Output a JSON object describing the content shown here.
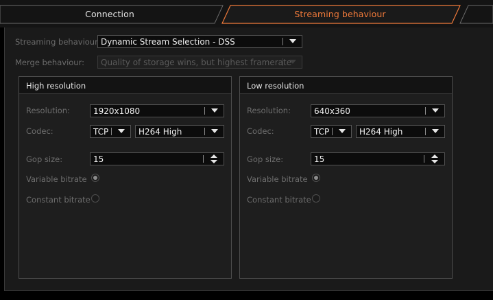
{
  "tabs": {
    "connection": "Connection",
    "streaming": "Streaming behaviour"
  },
  "colors": {
    "accent": "#f07a3a",
    "background": "#1a1a1a",
    "field": "#0c0c0c"
  },
  "form": {
    "streaming_label": "Streaming behaviour:",
    "streaming_value": "Dynamic Stream Selection - DSS",
    "merge_label": "Merge behaviour:",
    "merge_value": "Quality of storage wins, but highest framerate"
  },
  "high": {
    "title": "High resolution",
    "resolution_label": "Resolution:",
    "resolution_value": "1920x1080",
    "codec_label": "Codec:",
    "protocol_value": "TCP",
    "codec_value": "H264 High",
    "gop_label": "Gop size:",
    "gop_value": "15",
    "variable_label": "Variable bitrate",
    "constant_label": "Constant bitrate",
    "variable_selected": true
  },
  "low": {
    "title": "Low resolution",
    "resolution_label": "Resolution:",
    "resolution_value": "640x360",
    "codec_label": "Codec:",
    "protocol_value": "TCP",
    "codec_value": "H264 High",
    "gop_label": "Gop size:",
    "gop_value": "15",
    "variable_label": "Variable bitrate",
    "constant_label": "Constant bitrate",
    "variable_selected": true
  }
}
